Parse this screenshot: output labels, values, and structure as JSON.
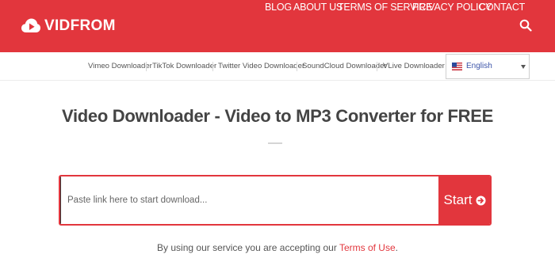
{
  "brand": {
    "name": "VIDFROM",
    "color": "#e2363d"
  },
  "nav": {
    "items": [
      "BLOG",
      "ABOUT US",
      "TERMS OF SERVICE",
      "PRIVACY POLICY",
      "CONTACT"
    ],
    "search_icon": "search-icon"
  },
  "subnav": {
    "items": [
      "Vimeo Downloader",
      "TikTok Downloader",
      "Twitter Video Downloader",
      "SoundCloud Downloader",
      "VLive Downloader"
    ]
  },
  "language": {
    "selected": "English",
    "flag_icon": "us-flag-icon"
  },
  "main": {
    "title": "Video Downloader - Video to MP3 Converter for FREE",
    "input_placeholder": "Paste link here to start download...",
    "start_label": "Start",
    "start_icon": "arrow-circle-right-icon",
    "terms_prefix": "By using our service you are accepting our ",
    "terms_link": "Terms of Use",
    "terms_suffix": "."
  }
}
